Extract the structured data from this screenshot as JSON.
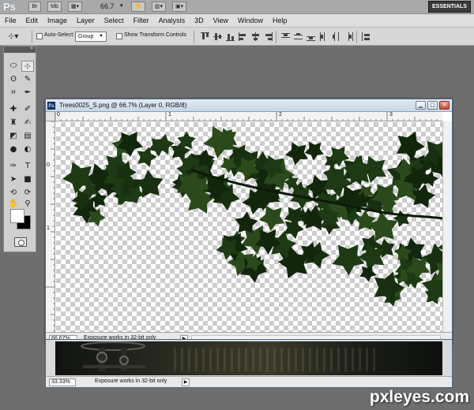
{
  "app": {
    "logo": "Ps",
    "bridge_label": "Br",
    "minibridge_label": "Mb",
    "zoom": "66.7",
    "workspace": "ESSENTIALS"
  },
  "menu": [
    "File",
    "Edit",
    "Image",
    "Layer",
    "Select",
    "Filter",
    "Analysis",
    "3D",
    "View",
    "Window",
    "Help"
  ],
  "options": {
    "auto_select_label": "Auto-Select:",
    "auto_select_value": "Group",
    "show_transform_label": "Show Transform Controls"
  },
  "document": {
    "title": "Trees0025_S.png @ 66.7% (Layer 0, RGB/8)",
    "zoom": "66.67%",
    "status": "Exposure works in 32-bit only",
    "ruler_top": [
      "0",
      "1",
      "2",
      "3"
    ],
    "ruler_left": [
      "0",
      "1"
    ]
  },
  "document2": {
    "zoom": "33.33%",
    "status": "Exposure works in 32-bit only"
  },
  "watermark": "pxleyes.com",
  "colors": {
    "foreground": "#ffffff",
    "background": "#000000",
    "leaf": "#1d3a14",
    "leaf_dark": "#12260c",
    "workspace_bg": "#6e6e6e"
  }
}
